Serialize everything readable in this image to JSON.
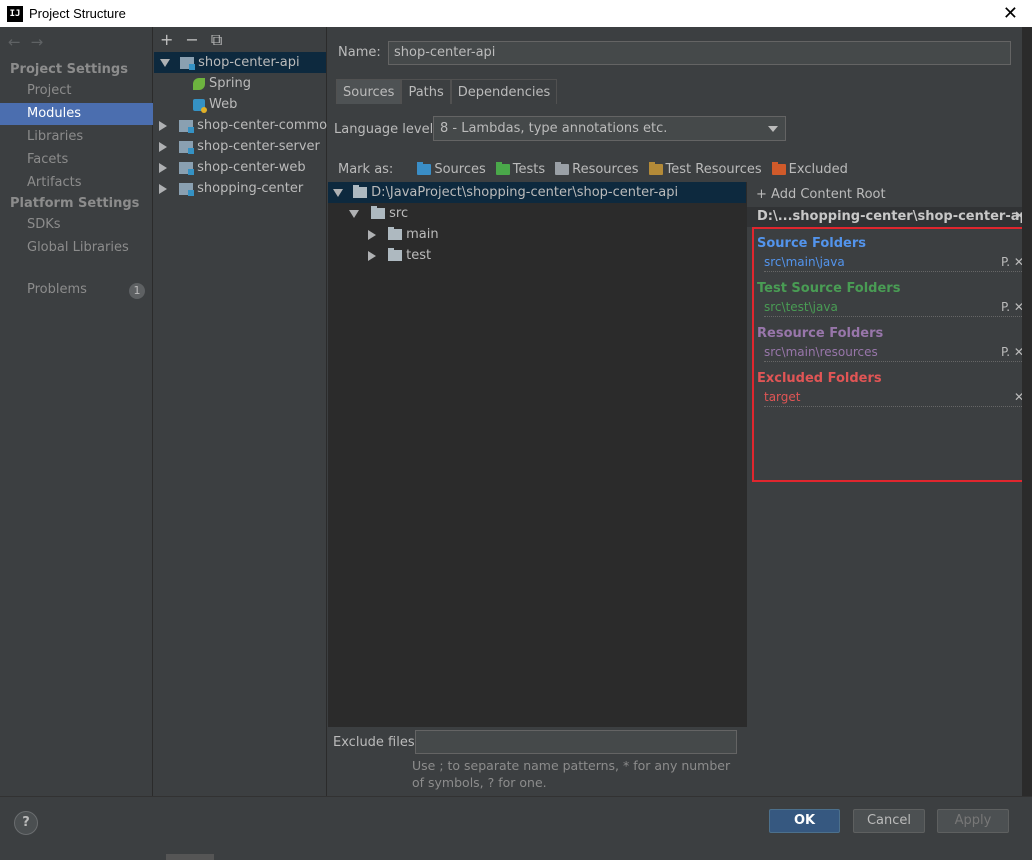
{
  "window": {
    "title": "Project Structure",
    "app_icon": "IJ"
  },
  "nav": {
    "back": "←",
    "forward": "→"
  },
  "project_settings": {
    "header": "Project Settings",
    "items": [
      "Project",
      "Modules",
      "Libraries",
      "Facets",
      "Artifacts"
    ]
  },
  "platform_settings": {
    "header": "Platform Settings",
    "items": [
      "SDKs",
      "Global Libraries"
    ]
  },
  "problems": {
    "label": "Problems",
    "count": "1"
  },
  "tree_toolbar": {
    "add": "+",
    "remove": "−",
    "copy": "⧉"
  },
  "modules": {
    "root": "shop-center-api",
    "children": [
      "Spring",
      "Web"
    ],
    "others": [
      "shop-center-common",
      "shop-center-server",
      "shop-center-web",
      "shopping-center"
    ]
  },
  "content": {
    "name_label": "Name:",
    "name_value": "shop-center-api",
    "tabs": [
      "Sources",
      "Paths",
      "Dependencies"
    ],
    "language_label": "Language level:",
    "language_value": "8 - Lambdas, type annotations etc.",
    "mark_as_label": "Mark as:",
    "mark_as": [
      {
        "label": "Sources",
        "color": "#3a8ec7"
      },
      {
        "label": "Tests",
        "color": "#4aa84a"
      },
      {
        "label": "Resources",
        "color": "#9aa0a6"
      },
      {
        "label": "Test Resources",
        "color": "#b38a38"
      },
      {
        "label": "Excluded",
        "color": "#d05a2a"
      }
    ]
  },
  "file_tree": {
    "root": "D:\\JavaProject\\shopping-center\\shop-center-api",
    "src": "src",
    "main": "main",
    "test": "test"
  },
  "roots": {
    "add_label": "+ Add Content Root",
    "path": "D:\\...shopping-center\\shop-center-api",
    "groups": [
      {
        "title": "Source Folders",
        "color": "#5394ec",
        "item": "src\\main\\java",
        "actions": "P.  ✕"
      },
      {
        "title": "Test Source Folders",
        "color": "#499c54",
        "item": "src\\test\\java",
        "actions": "P.  ✕"
      },
      {
        "title": "Resource Folders",
        "color": "#9876aa",
        "item": "src\\main\\resources",
        "actions": "P.  ✕"
      },
      {
        "title": "Excluded Folders",
        "color": "#e05555",
        "item": "target",
        "actions": "✕"
      }
    ]
  },
  "exclude": {
    "label": "Exclude files:",
    "hint": "Use ; to separate name patterns, * for any number of symbols, ? for one."
  },
  "buttons": {
    "help": "?",
    "ok": "OK",
    "cancel": "Cancel",
    "apply": "Apply"
  }
}
